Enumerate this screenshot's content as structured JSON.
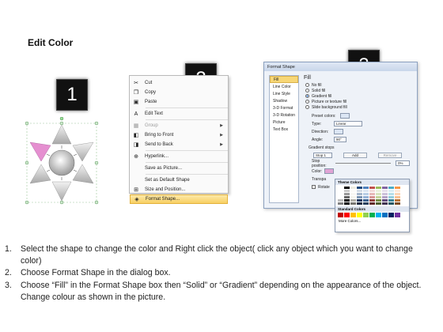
{
  "title": "Edit Color",
  "badges": [
    "1",
    "2",
    "3"
  ],
  "menu": {
    "items": [
      {
        "icon": "scissors-icon",
        "glyph": "✂",
        "label": "Cut"
      },
      {
        "icon": "copy-icon",
        "glyph": "❐",
        "label": "Copy"
      },
      {
        "icon": "paste-icon",
        "glyph": "▣",
        "label": "Paste"
      },
      {
        "icon": "edit-text-icon",
        "glyph": "A",
        "label": "Edit Text"
      },
      {
        "icon": "group-icon",
        "glyph": "▦",
        "label": "Group"
      },
      {
        "icon": "bring-front-icon",
        "glyph": "◧",
        "label": "Bring to Front"
      },
      {
        "icon": "send-back-icon",
        "glyph": "◨",
        "label": "Send to Back"
      },
      {
        "icon": "hyperlink-icon",
        "glyph": "⊕",
        "label": "Hyperlink..."
      },
      {
        "icon": "save-picture-icon",
        "glyph": "",
        "label": "Save as Picture..."
      },
      {
        "icon": "default-shape-icon",
        "glyph": "",
        "label": "Set as Default Shape"
      },
      {
        "icon": "size-position-icon",
        "glyph": "⊞",
        "label": "Size and Position..."
      },
      {
        "icon": "format-shape-icon",
        "glyph": "◈",
        "label": "Format Shape..."
      }
    ]
  },
  "dialog": {
    "title": "Format Shape",
    "nav": [
      "Fill",
      "Line Color",
      "Line Style",
      "Shadow",
      "3-D Format",
      "3-D Rotation",
      "Picture",
      "Text Box"
    ],
    "fill_heading": "Fill",
    "options": [
      "No fill",
      "Solid fill",
      "Gradient fill",
      "Picture or texture fill",
      "Slide background fill"
    ],
    "preset_label": "Preset colors:",
    "type_label": "Type:",
    "type_value": "Linear",
    "direction_label": "Direction:",
    "angle_label": "Angle:",
    "angle_value": "90°",
    "gradient_stops_label": "Gradient stops",
    "stop_value": "Stop 1",
    "add_label": "Add",
    "remove_label": "Remove",
    "stop_position_label": "Stop position:",
    "stop_position_value": "0%",
    "color_label": "Color:",
    "transparency_label": "Transpa",
    "rotate_label": "Rotate"
  },
  "palette": {
    "theme_label": "Theme Colors",
    "standard_label": "Standard Colors",
    "more_label": "More Colors...",
    "theme_columns": [
      "#ffffff",
      "#000000",
      "#eeece1",
      "#1f497d",
      "#4f81bd",
      "#c0504d",
      "#9bbb59",
      "#8064a2",
      "#4bacc6",
      "#f79646"
    ],
    "standard": [
      "#c00000",
      "#ff0000",
      "#ffc000",
      "#ffff00",
      "#92d050",
      "#00b050",
      "#00b0f0",
      "#0070c0",
      "#002060",
      "#7030a0"
    ]
  },
  "instructions": [
    {
      "num": "1.",
      "text": "Select the shape to change the color and Right click the object( click any object which you want to change color)"
    },
    {
      "num": "2.",
      "text": "Choose Format Shape in the dialog box."
    },
    {
      "num": "3.",
      "text": "Choose “Fill” in the Format Shape box then “Solid” or “Gradient” depending on the appearance of the object. Change colour as shown in the picture."
    }
  ]
}
